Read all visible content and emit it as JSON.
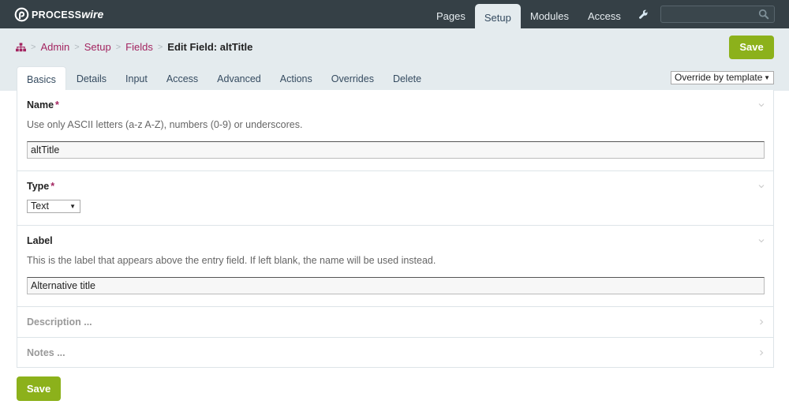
{
  "brand": {
    "name_part1": "PROCESS",
    "name_part2": "wire"
  },
  "topnav": {
    "items": [
      {
        "label": "Pages",
        "active": false
      },
      {
        "label": "Setup",
        "active": true
      },
      {
        "label": "Modules",
        "active": false
      },
      {
        "label": "Access",
        "active": false
      }
    ],
    "wrench_icon": "wrench-icon",
    "search": {
      "value": "",
      "placeholder": ""
    }
  },
  "breadcrumb": {
    "home_icon": "sitemap-icon",
    "links": [
      "Admin",
      "Setup",
      "Fields"
    ],
    "separator": ">",
    "current": "Edit Field: altTitle"
  },
  "actions": {
    "save_label": "Save"
  },
  "tabs": [
    {
      "label": "Basics",
      "active": true
    },
    {
      "label": "Details",
      "active": false
    },
    {
      "label": "Input",
      "active": false
    },
    {
      "label": "Access",
      "active": false
    },
    {
      "label": "Advanced",
      "active": false
    },
    {
      "label": "Actions",
      "active": false
    },
    {
      "label": "Overrides",
      "active": false
    },
    {
      "label": "Delete",
      "active": false
    }
  ],
  "override_select": {
    "selected": "Override by template"
  },
  "fields": {
    "name": {
      "label": "Name",
      "required_mark": "*",
      "note": "Use only ASCII letters (a-z A-Z), numbers (0-9) or underscores.",
      "value": "altTitle"
    },
    "type": {
      "label": "Type",
      "required_mark": "*",
      "selected": "Text"
    },
    "label": {
      "label": "Label",
      "note": "This is the label that appears above the entry field. If left blank, the name will be used instead.",
      "value": "Alternative title"
    },
    "description": {
      "label": "Description ..."
    },
    "notes": {
      "label": "Notes ..."
    }
  },
  "colors": {
    "masthead": "#354046",
    "subhead": "#e4ebee",
    "accent_link": "#a32560",
    "save_button": "#8cb11b"
  }
}
